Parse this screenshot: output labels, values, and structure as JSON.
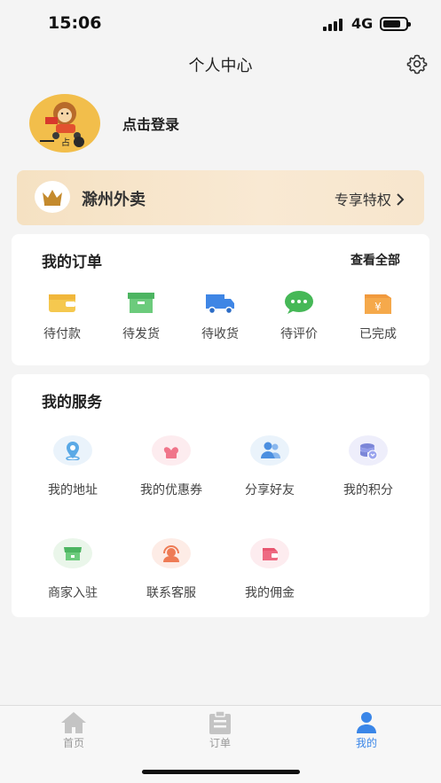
{
  "status_bar": {
    "time": "15:06",
    "network": "4G"
  },
  "header": {
    "title": "个人中心",
    "settings_icon": "gear-icon"
  },
  "profile": {
    "login_label": "点击登录",
    "avatar_icon": "lion-mascot-avatar"
  },
  "vip": {
    "title": "滁州外卖",
    "link_label": "专享特权",
    "icon": "crown-icon",
    "accent": "#f5e1c2"
  },
  "orders": {
    "title": "我的订单",
    "view_all": "查看全部",
    "items": [
      {
        "label": "待付款",
        "icon": "wallet-icon"
      },
      {
        "label": "待发货",
        "icon": "box-icon"
      },
      {
        "label": "待收货",
        "icon": "truck-icon"
      },
      {
        "label": "待评价",
        "icon": "chat-bubble-icon"
      },
      {
        "label": "已完成",
        "icon": "yen-bag-icon"
      }
    ]
  },
  "services": {
    "title": "我的服务",
    "items": [
      {
        "label": "我的地址",
        "icon": "location-icon"
      },
      {
        "label": "我的优惠券",
        "icon": "heart-coupon-icon"
      },
      {
        "label": "分享好友",
        "icon": "users-icon"
      },
      {
        "label": "我的积分",
        "icon": "coins-icon"
      },
      {
        "label": "商家入驻",
        "icon": "store-icon"
      },
      {
        "label": "联系客服",
        "icon": "customer-service-icon"
      },
      {
        "label": "我的佣金",
        "icon": "purse-icon"
      }
    ]
  },
  "tabbar": {
    "tabs": [
      {
        "label": "首页",
        "icon": "home-icon"
      },
      {
        "label": "订单",
        "icon": "clipboard-icon"
      },
      {
        "label": "我的",
        "icon": "user-icon"
      }
    ],
    "active_color": "#3a86e8"
  }
}
